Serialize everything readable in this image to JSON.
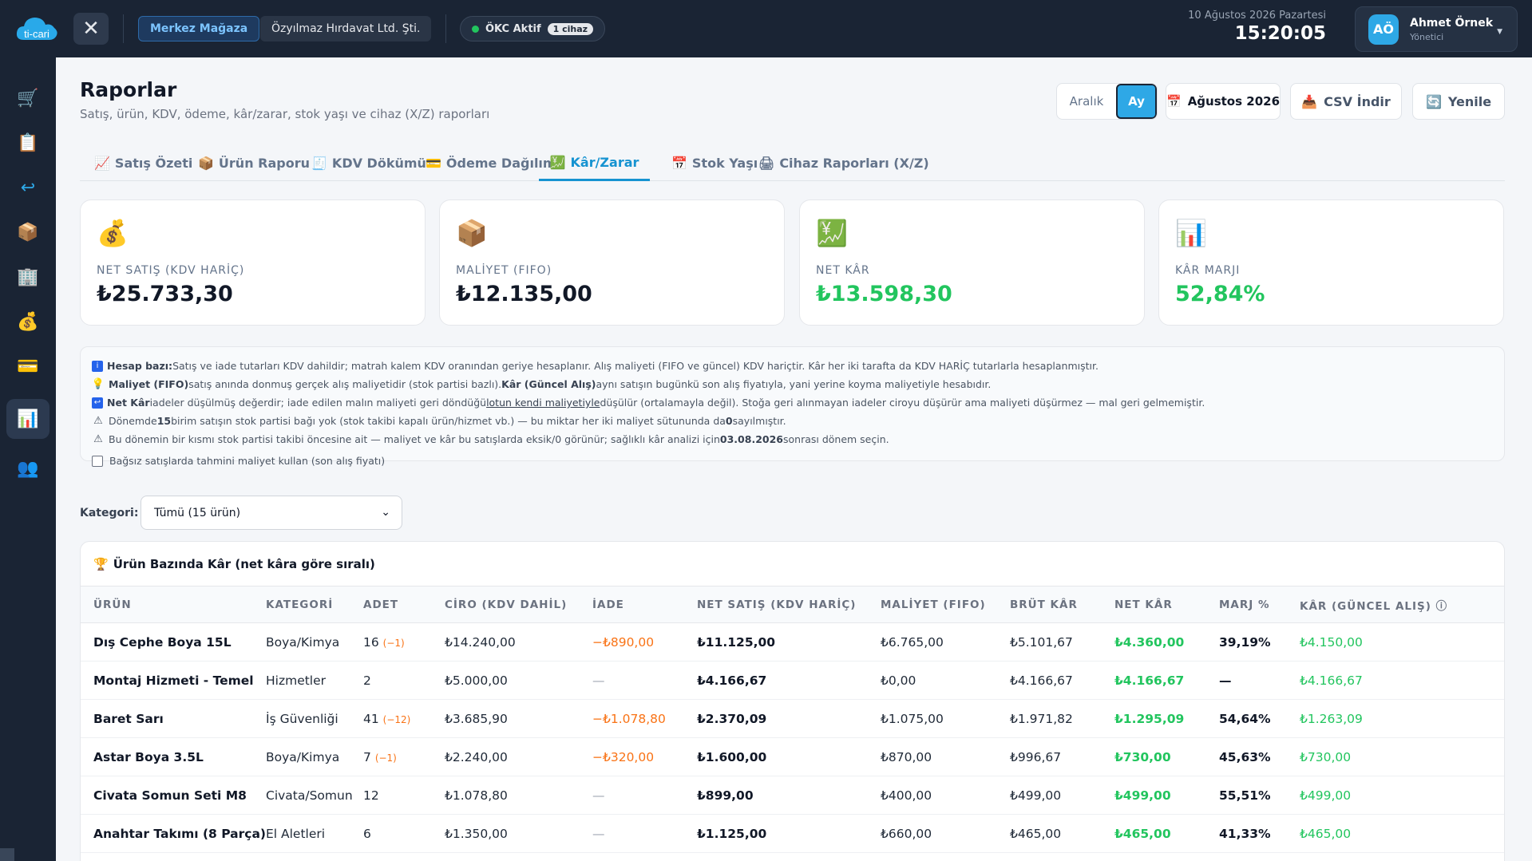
{
  "topbar": {
    "logo_text": "ti-cari",
    "store": "Merkez Mağaza",
    "company": "Özyılmaz Hırdavat Ltd. Şti.",
    "okc_label": "ÖKC Aktif",
    "okc_badge": "1 cihaz",
    "date": "10 Ağustos 2026 Pazartesi",
    "time": "15:20:05",
    "user_initials": "AÖ",
    "user_name": "Ahmet Örnek",
    "user_role": "Yönetici"
  },
  "sidebar": {
    "items": [
      {
        "icon": "cart-icon",
        "glyph": "🛒"
      },
      {
        "icon": "clipboard-icon",
        "glyph": "📋"
      },
      {
        "icon": "return-icon",
        "glyph": "↩"
      },
      {
        "icon": "box-icon",
        "glyph": "📦"
      },
      {
        "icon": "building-icon",
        "glyph": "🏢"
      },
      {
        "icon": "money-bag-icon",
        "glyph": "💰"
      },
      {
        "icon": "card-icon",
        "glyph": "💳"
      },
      {
        "icon": "chart-icon",
        "glyph": "📊"
      },
      {
        "icon": "users-icon",
        "glyph": "👥"
      }
    ],
    "active_index": 7
  },
  "header": {
    "title": "Raporlar",
    "subtitle": "Satış, ürün, KDV, ödeme, kâr/zarar, stok yaşı ve cihaz (X/Z) raporları",
    "range_label": "Aralık",
    "month_label": "Ay",
    "period": "Ağustos 2026",
    "csv_label": "CSV İndir",
    "refresh_label": "Yenile"
  },
  "tabs": [
    {
      "label": "Satış Özeti",
      "icon": "📈"
    },
    {
      "label": "Ürün Raporu",
      "icon": "📦"
    },
    {
      "label": "KDV Dökümü",
      "icon": "🧾"
    },
    {
      "label": "Ödeme Dağılımı",
      "icon": "💳"
    },
    {
      "label": "Kâr/Zarar",
      "icon": "💹"
    },
    {
      "label": "Stok Yaşı",
      "icon": "📅"
    },
    {
      "label": "Cihaz Raporları (X/Z)",
      "icon": "🖨"
    }
  ],
  "active_tab": 4,
  "kpis": [
    {
      "icon": "💰",
      "label": "NET SATIŞ (KDV HARİÇ)",
      "value": "₺25.733,30",
      "accent": "#111827"
    },
    {
      "icon": "📦",
      "label": "MALİYET (FIFO)",
      "value": "₺12.135,00",
      "accent": "#111827"
    },
    {
      "icon": "💹",
      "label": "NET KÂR",
      "value": "₺13.598,30",
      "accent": "#22c55e"
    },
    {
      "icon": "📊",
      "label": "KÂR MARJI",
      "value": "52,84%",
      "accent": "#22c55e"
    }
  ],
  "notes": {
    "n1_bold": "Hesap bazı:",
    "n1_text": " Satış ve iade tutarları KDV dahildir; matrah kalem KDV oranından geriye hesaplanır. Alış maliyeti (FIFO ve güncel) KDV hariçtir. Kâr her iki tarafta da KDV HARİÇ tutarlarla hesaplanmıştır.",
    "n2_bold1": "Maliyet (FIFO)",
    "n2_text1": " satış anında donmuş gerçek alış maliyetidir (stok partisi bazlı). ",
    "n2_bold2": "Kâr (Güncel Alış)",
    "n2_text2": " aynı satışın bugünkü son alış fiyatıyla, yani yerine koyma maliyetiyle hesabıdır.",
    "n3_bold": "Net Kâr",
    "n3_text1": " iadeler düşülmüş değerdir; iade edilen malın maliyeti geri döndüğü ",
    "n3_link": "lotun kendi maliyetiyle",
    "n3_text2": " düşülür (ortalamayla değil). Stoğa geri alınmayan iadeler ciroyu düşürür ama maliyeti düşürmez — mal geri gelmemiştir.",
    "n4_text1": "Dönemde ",
    "n4_bold1": "15",
    "n4_text2": " birim satışın stok partisi bağı yok (stok takibi kapalı ürün/hizmet vb.) — bu miktar her iki maliyet sütununda da ",
    "n4_bold2": "0",
    "n4_text3": " sayılmıştır.",
    "n5_text1": "Bu dönemin bir kısmı stok partisi takibi öncesine ait — maliyet ve kâr bu satışlarda eksik/0 görünür; sağlıklı kâr analizi için ",
    "n5_bold": "03.08.2026",
    "n5_text2": " sonrası dönem seçin.",
    "checkbox_label": "Bağsız satışlarda tahmini maliyet kullan (son alış fiyatı)"
  },
  "filter": {
    "label": "Kategori:",
    "selected": "Tümü (15 ürün)"
  },
  "table": {
    "title": "Ürün Bazında Kâr (net kâra göre sıralı)",
    "columns": [
      "ÜRÜN",
      "KATEGORİ",
      "ADET",
      "CİRO (KDV DAHİL)",
      "İADE",
      "NET SATIŞ (KDV HARİÇ)",
      "MALİYET (FIFO)",
      "BRÜT KÂR",
      "NET KÂR",
      "MARJ %",
      "KÂR (GÜNCEL ALIŞ) ⓘ"
    ],
    "rows": [
      {
        "product": "Dış Cephe Boya 15L",
        "category": "Boya/Kimya",
        "qty": "16",
        "qty_sub": "(−1)",
        "revenue": "₺14.240,00",
        "refund": "−₺890,00",
        "net_sales": "₺11.125,00",
        "cost": "₺6.765,00",
        "gross": "₺5.101,67",
        "net_profit": "₺4.360,00",
        "margin": "39,19%",
        "current_profit": "₺4.150,00"
      },
      {
        "product": "Montaj Hizmeti - Temel",
        "category": "Hizmetler",
        "qty": "2",
        "qty_sub": "",
        "revenue": "₺5.000,00",
        "refund": "—",
        "net_sales": "₺4.166,67",
        "cost": "₺0,00",
        "gross": "₺4.166,67",
        "net_profit": "₺4.166,67",
        "margin": "—",
        "current_profit": "₺4.166,67"
      },
      {
        "product": "Baret Sarı",
        "category": "İş Güvenliği",
        "qty": "41",
        "qty_sub": "(−12)",
        "revenue": "₺3.685,90",
        "refund": "−₺1.078,80",
        "net_sales": "₺2.370,09",
        "cost": "₺1.075,00",
        "gross": "₺1.971,82",
        "net_profit": "₺1.295,09",
        "margin": "54,64%",
        "current_profit": "₺1.263,09"
      },
      {
        "product": "Astar Boya 3.5L",
        "category": "Boya/Kimya",
        "qty": "7",
        "qty_sub": "(−1)",
        "revenue": "₺2.240,00",
        "refund": "−₺320,00",
        "net_sales": "₺1.600,00",
        "cost": "₺870,00",
        "gross": "₺996,67",
        "net_profit": "₺730,00",
        "margin": "45,63%",
        "current_profit": "₺730,00"
      },
      {
        "product": "Civata Somun Seti M8",
        "category": "Civata/Somun",
        "qty": "12",
        "qty_sub": "",
        "revenue": "₺1.078,80",
        "refund": "—",
        "net_sales": "₺899,00",
        "cost": "₺400,00",
        "gross": "₺499,00",
        "net_profit": "₺499,00",
        "margin": "55,51%",
        "current_profit": "₺499,00"
      },
      {
        "product": "Anahtar Takımı (8 Parça)",
        "category": "El Aletleri",
        "qty": "6",
        "qty_sub": "",
        "revenue": "₺1.350,00",
        "refund": "—",
        "net_sales": "₺1.125,00",
        "cost": "₺660,00",
        "gross": "₺465,00",
        "net_profit": "₺465,00",
        "margin": "41,33%",
        "current_profit": "₺465,00"
      }
    ]
  }
}
